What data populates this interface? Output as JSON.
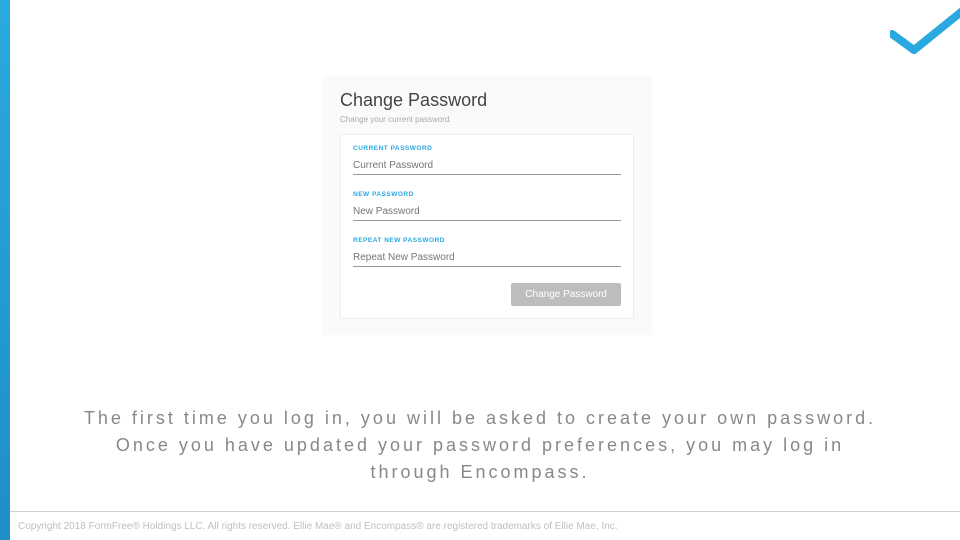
{
  "brand": {
    "accent": "#2aa9e0"
  },
  "checkmark": {
    "semantic": "checkmark-logo"
  },
  "panel": {
    "title": "Change Password",
    "subtitle": "Change your current password.",
    "fields": {
      "current": {
        "label": "CURRENT PASSWORD",
        "placeholder": "Current Password"
      },
      "newpw": {
        "label": "NEW PASSWORD",
        "placeholder": "New Password"
      },
      "repeat": {
        "label": "REPEAT NEW PASSWORD",
        "placeholder": "Repeat New Password"
      }
    },
    "button": "Change Password"
  },
  "caption": "The first time you log in, you will be asked to create your own password. Once you have updated your password preferences, you may log in through Encompass.",
  "footer": "Copyright 2018 FormFree® Holdings LLC. All rights reserved. Ellie Mae® and Encompass® are registered trademarks of Ellie Mae, Inc."
}
